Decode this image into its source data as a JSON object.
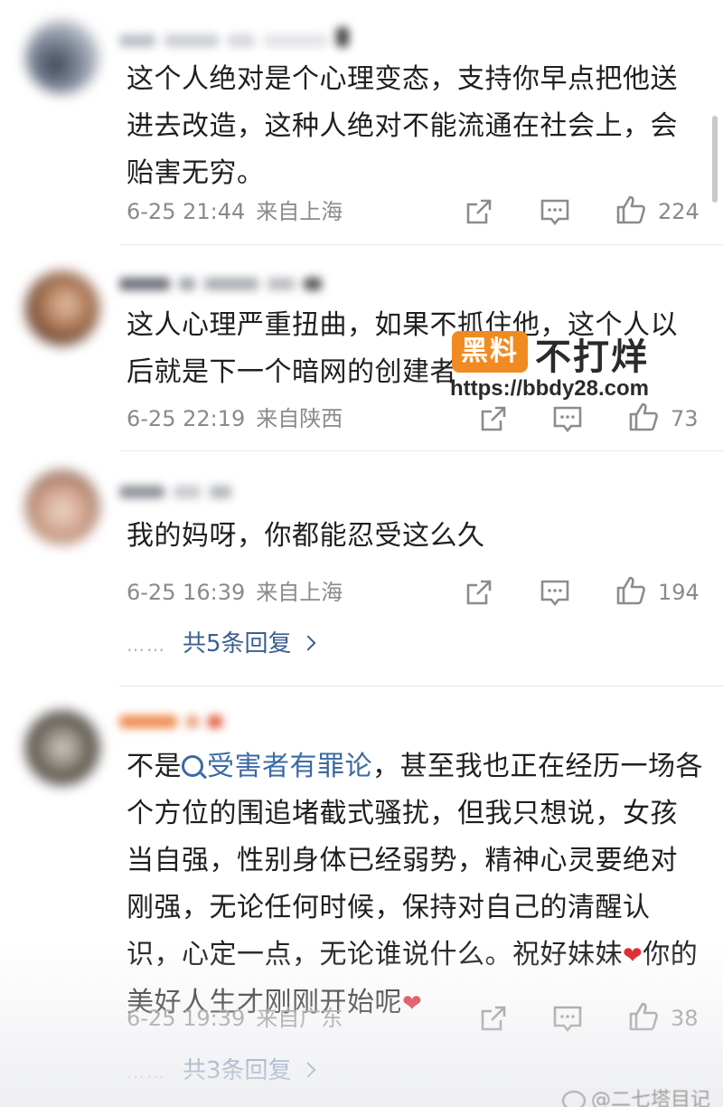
{
  "comments": [
    {
      "text": "这个人绝对是个心理变态，支持你早点把他送进去改造，这种人绝对不能流通在社会上，会贻害无穷。",
      "date": "6-25 21:44",
      "location": "来自上海",
      "likes": "224"
    },
    {
      "text": "这人心理严重扭曲，如果不抓住他，这个人以后就是下一个暗网的创建者",
      "date": "6-25 22:19",
      "location": "来自陕西",
      "likes": "73"
    },
    {
      "text": "我的妈呀，你都能忍受这么久",
      "date": "6-25 16:39",
      "location": "来自上海",
      "likes": "194",
      "replies": "共5条回复"
    },
    {
      "text_before": "不是",
      "topic": "受害者有罪论",
      "text_after": "，甚至我也正在经历一场各个方位的围追堵截式骚扰，但我只想说，女孩当自强，性别身体已经弱势，精神心灵要绝对刚强，无论任何时候，保持对自己的清醒认识，心定一点，无论谁说什么。祝好妹妹",
      "text_end": "你的美好人生才刚刚开始呢",
      "date": "6-25 19:39",
      "location": "来自广东",
      "likes": "38",
      "replies": "共3条回复"
    }
  ],
  "replies_dots": "……",
  "watermark": {
    "badge": "黑料",
    "title": "不打烊",
    "url": "https://bbdy28.com"
  },
  "credit": "@二七塔目记",
  "icons": [
    "share-icon",
    "comment-icon",
    "thumbs-up-icon",
    "heart-icon",
    "search-icon",
    "chevron-right-icon",
    "weibo-icon"
  ],
  "colors": {
    "link": "#3b6aa5",
    "meta": "#8a8a8a",
    "heart": "#e0202a",
    "watermark_badge": "#f28a22"
  }
}
